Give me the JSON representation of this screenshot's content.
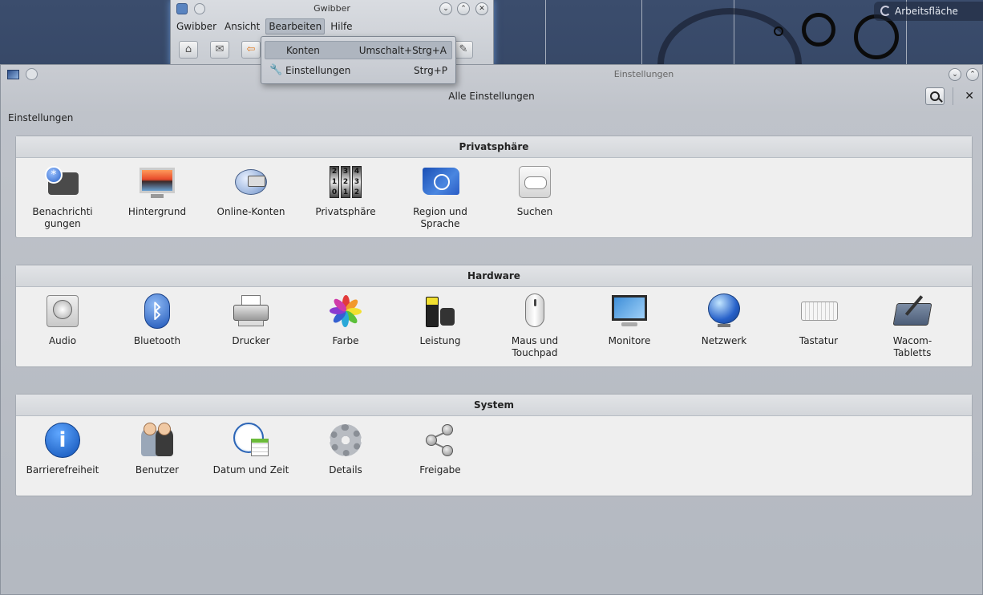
{
  "desktop": {
    "workspace_label": "Arbeitsfläche"
  },
  "gwibber": {
    "title": "Gwibber",
    "menu": [
      "Gwibber",
      "Ansicht",
      "Bearbeiten",
      "Hilfe"
    ],
    "active_menu_index": 2,
    "dropdown": {
      "items": [
        {
          "label": "Konten",
          "shortcut": "Umschalt+Strg+A",
          "highlighted": true,
          "icon": ""
        },
        {
          "label": "Einstellungen",
          "shortcut": "Strg+P",
          "highlighted": false,
          "icon": "wrench-icon"
        }
      ]
    },
    "toolbar_icons": [
      "home-icon",
      "mail-icon",
      "reply-icon",
      "compose-icon"
    ]
  },
  "settings": {
    "title": "Einstellungen",
    "header": "Alle Einstellungen",
    "breadcrumb": "Einstellungen",
    "sections": [
      {
        "title": "Privatsphäre",
        "items": [
          {
            "label": "Benachrichtigungen",
            "lines": [
              "Benachrichti",
              "gungen"
            ],
            "icon": "notification-icon"
          },
          {
            "label": "Hintergrund",
            "lines": [
              "Hintergrund",
              ""
            ],
            "icon": "wallpaper-icon"
          },
          {
            "label": "Online-Konten",
            "lines": [
              "Online-Konten",
              ""
            ],
            "icon": "online-accounts-icon"
          },
          {
            "label": "Privatsphäre",
            "lines": [
              "Privatsphäre",
              ""
            ],
            "icon": "privacy-icon"
          },
          {
            "label": "Region und Sprache",
            "lines": [
              "Region und",
              "Sprache"
            ],
            "icon": "region-icon"
          },
          {
            "label": "Suchen",
            "lines": [
              "Suchen",
              ""
            ],
            "icon": "search-settings-icon"
          }
        ]
      },
      {
        "title": "Hardware",
        "items": [
          {
            "label": "Audio",
            "lines": [
              "Audio",
              ""
            ],
            "icon": "audio-icon"
          },
          {
            "label": "Bluetooth",
            "lines": [
              "Bluetooth",
              ""
            ],
            "icon": "bluetooth-icon"
          },
          {
            "label": "Drucker",
            "lines": [
              "Drucker",
              ""
            ],
            "icon": "printer-icon"
          },
          {
            "label": "Farbe",
            "lines": [
              "Farbe",
              ""
            ],
            "icon": "color-icon"
          },
          {
            "label": "Leistung",
            "lines": [
              "Leistung",
              ""
            ],
            "icon": "power-icon"
          },
          {
            "label": "Maus und Touchpad",
            "lines": [
              "Maus und",
              "Touchpad"
            ],
            "icon": "mouse-icon"
          },
          {
            "label": "Monitore",
            "lines": [
              "Monitore",
              ""
            ],
            "icon": "monitor-icon"
          },
          {
            "label": "Netzwerk",
            "lines": [
              "Netzwerk",
              ""
            ],
            "icon": "network-icon"
          },
          {
            "label": "Tastatur",
            "lines": [
              "Tastatur",
              ""
            ],
            "icon": "keyboard-icon"
          },
          {
            "label": "Wacom-Tabletts",
            "lines": [
              "Wacom-",
              "Tabletts"
            ],
            "icon": "wacom-icon"
          }
        ]
      },
      {
        "title": "System",
        "items": [
          {
            "label": "Barrierefreiheit",
            "lines": [
              "Barrierefreiheit",
              ""
            ],
            "icon": "accessibility-icon"
          },
          {
            "label": "Benutzer",
            "lines": [
              "Benutzer",
              ""
            ],
            "icon": "users-icon"
          },
          {
            "label": "Datum und Zeit",
            "lines": [
              "Datum und Zeit",
              ""
            ],
            "icon": "datetime-icon"
          },
          {
            "label": "Details",
            "lines": [
              "Details",
              ""
            ],
            "icon": "details-icon"
          },
          {
            "label": "Freigabe",
            "lines": [
              "Freigabe",
              ""
            ],
            "icon": "sharing-icon"
          }
        ]
      }
    ]
  }
}
